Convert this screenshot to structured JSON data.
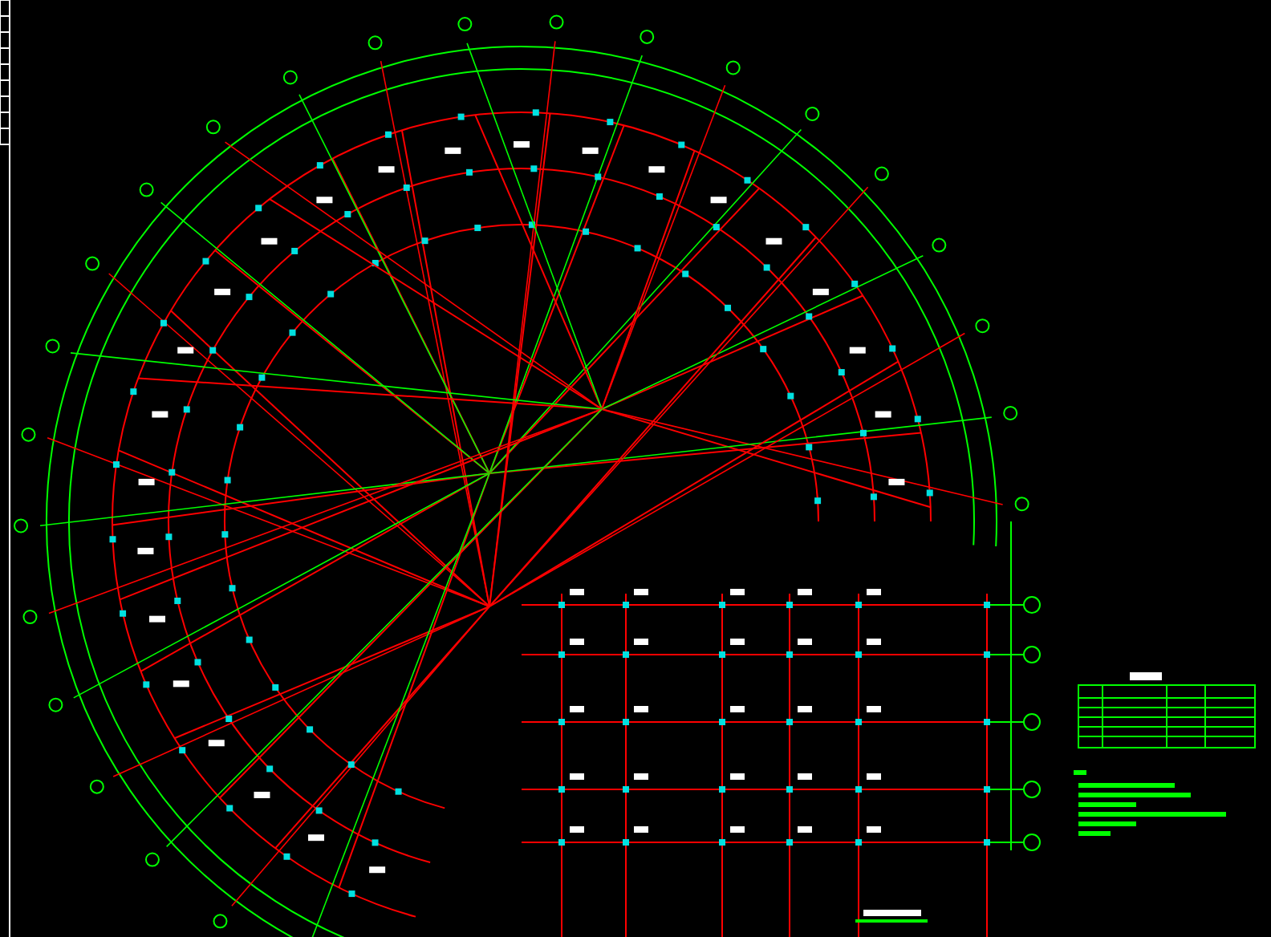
{
  "drawing": {
    "kind": "fan-grid-plan"
  }
}
